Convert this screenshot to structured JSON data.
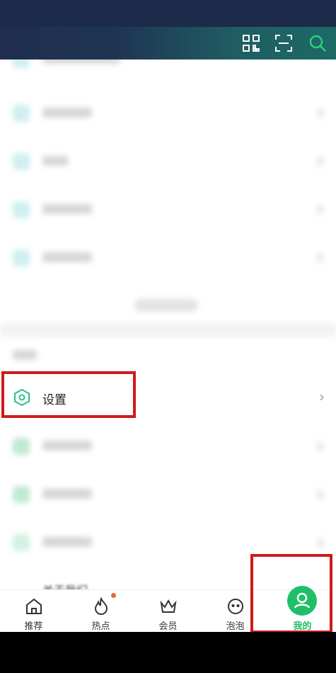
{
  "header": {
    "icons": [
      "qr-code-icon",
      "scan-icon",
      "search-icon"
    ]
  },
  "content": {
    "settings_label": "设置",
    "about_label": "关于我们"
  },
  "tabbar": {
    "tabs": [
      {
        "label": "推荐",
        "icon": "home-icon"
      },
      {
        "label": "热点",
        "icon": "flame-icon",
        "has_dot": true
      },
      {
        "label": "会员",
        "icon": "crown-icon"
      },
      {
        "label": "泡泡",
        "icon": "bubble-face-icon"
      },
      {
        "label": "我的",
        "icon": "user-icon",
        "active": true
      }
    ]
  },
  "colors": {
    "accent": "#1fbf6a",
    "highlight_box": "#cf1a1a",
    "header_start": "#1f2d4f",
    "header_end": "#1c6a66"
  }
}
